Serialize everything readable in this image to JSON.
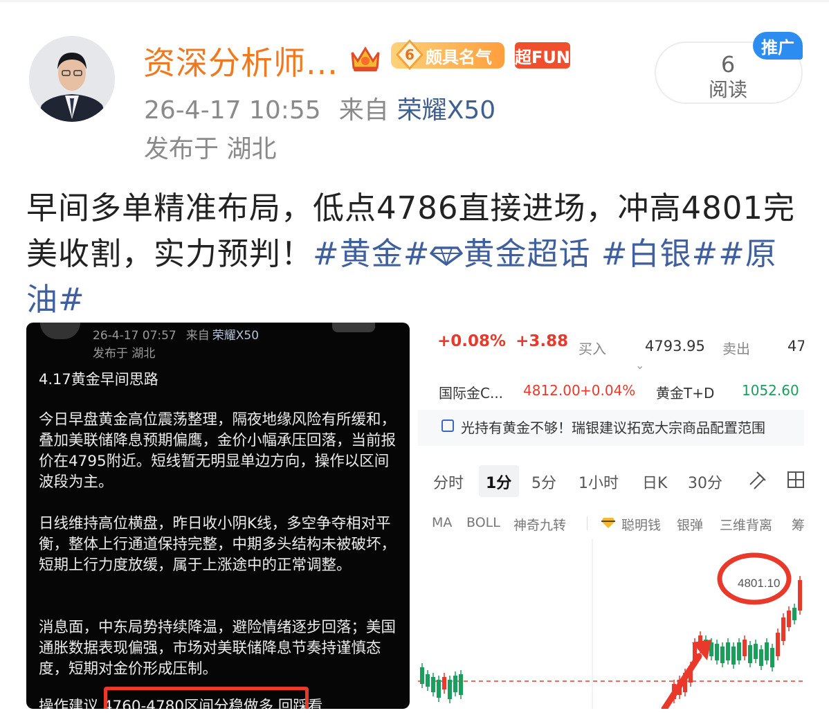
{
  "post": {
    "username": "资深分析师...",
    "fame_level": "6",
    "fame_label": "颇具名气",
    "super_label": "超FUN",
    "timestamp": "26-4-17 10:55",
    "from_label": "来自",
    "device": "荣耀X50",
    "location": "发布于 湖北",
    "read_count": "6",
    "read_label": "阅读",
    "promo_tag": "推广",
    "text_main": "早间多单精准布局，低点4786直接进场，冲高4801完美收割，实力预判！",
    "tags": {
      "tag1": "#黄金#",
      "tag2": "黄金超话",
      "tag3": "#白银#",
      "tag4": "#原油#"
    }
  },
  "left_image": {
    "timestamp": "26-4-17 07:57",
    "from_label": "来自",
    "device": "荣耀X50",
    "location": "发布于 湖北",
    "title": "4.17黄金早间思路",
    "para1": "今日早盘黄金高位震荡整理，隔夜地缘风险有所缓和，叠加美联储降息预期偏鹰，金价小幅承压回落，当前报价在4795附近。短线暂无明显单边方向，操作以区间波段为主。",
    "para2": "日线维持高位横盘，昨日收小阴K线，多空争夺相对平衡，整体上行通道保持完整，中期多头结构未被破坏，短期上行力度放缓，属于上涨途中的正常调整。",
    "para3": "消息面，中东局势持续降温，避险情绪逐步回落；美国通胀数据表现偏强，市场对美联储降息节奏持谨慎态度，短期对金价形成压制。",
    "para4": "操作建议 4760-4780区间分稳做多 回踩看"
  },
  "right_image": {
    "change_pct": "+0.08%",
    "change_abs": "+3.88",
    "buy_label": "买入",
    "buy_value": "4793.95",
    "sell_label": "卖出",
    "sell_value": "47",
    "intl_gold_label": "国际金C...",
    "intl_gold_price": "4812.00",
    "intl_gold_change": "+0.04%",
    "td_label": "黄金T+D",
    "td_price": "1052.60",
    "news": "光持有黄金不够！瑞银建议拓宽大宗商品配置范围",
    "tabs": [
      "分时",
      "1分",
      "5分",
      "1小时",
      "日K",
      "30分"
    ],
    "active_tab": "1分",
    "indicators": [
      "MA",
      "BOLL",
      "神奇九转",
      "聪明钱",
      "银弹",
      "三维背离",
      "筹"
    ],
    "annotated_price": "4801.10"
  },
  "colors": {
    "username": "#f0781e",
    "hashtag": "#3f5f9f",
    "rise": "#e8392b",
    "fall": "#1a9e5c",
    "promo": "#2c8cf0"
  }
}
